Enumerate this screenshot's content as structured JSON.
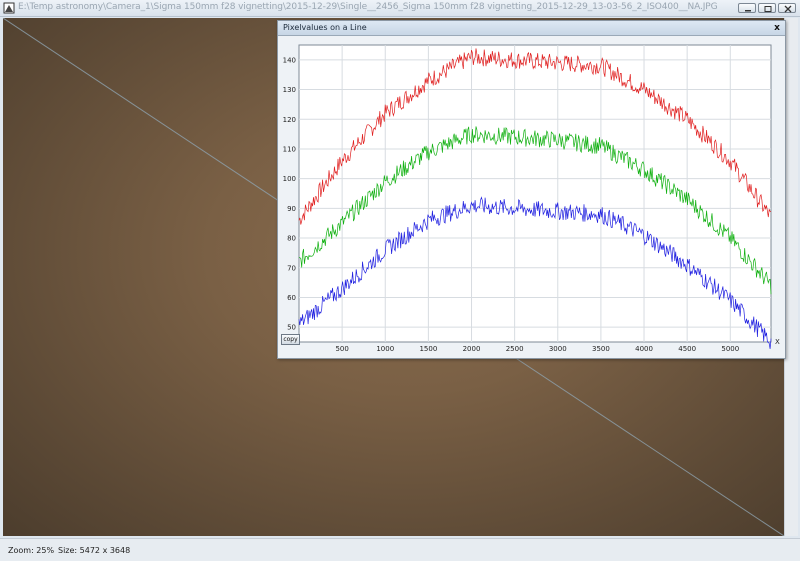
{
  "window": {
    "title": "E:\\Temp astronomy\\Camera_1\\Sigma 150mm f28 vignetting\\2015-12-29\\Single__2456_Sigma 150mm f28 vignetting_2015-12-29_13-03-56_2_ISO400__NA.JPG",
    "minimize_icon": "minimize-icon",
    "maximize_icon": "maximize-icon",
    "close_icon": "close-icon"
  },
  "status": {
    "zoom": "Zoom: 25%",
    "size": "Size: 5472 x 3648"
  },
  "plot_window": {
    "title": "Pixelvalues on a Line",
    "close_label": "x",
    "copy_label": "copy"
  },
  "chart_data": {
    "type": "line",
    "title": "",
    "xlabel": "X",
    "ylabel": "",
    "xlim": [
      0,
      5472
    ],
    "ylim": [
      45,
      145
    ],
    "grid": true,
    "x_ticks": [
      500,
      1000,
      1500,
      2000,
      2500,
      3000,
      3500,
      4000,
      4500,
      5000
    ],
    "y_ticks": [
      50,
      60,
      70,
      80,
      90,
      100,
      110,
      120,
      130,
      140
    ],
    "x": [
      0,
      500,
      1000,
      1500,
      2000,
      2500,
      3000,
      3500,
      4000,
      4500,
      5000,
      5472
    ],
    "series": [
      {
        "color": "#e02020",
        "values": [
          86,
          106,
          122,
          133,
          141,
          140,
          139,
          138,
          130,
          120,
          106,
          87
        ]
      },
      {
        "color": "#10b010",
        "values": [
          72,
          85,
          99,
          109,
          115,
          114,
          113,
          111,
          103,
          93,
          80,
          64
        ]
      },
      {
        "color": "#2020e0",
        "values": [
          51,
          63,
          76,
          86,
          91,
          90,
          89,
          88,
          81,
          71,
          59,
          45
        ]
      }
    ]
  }
}
